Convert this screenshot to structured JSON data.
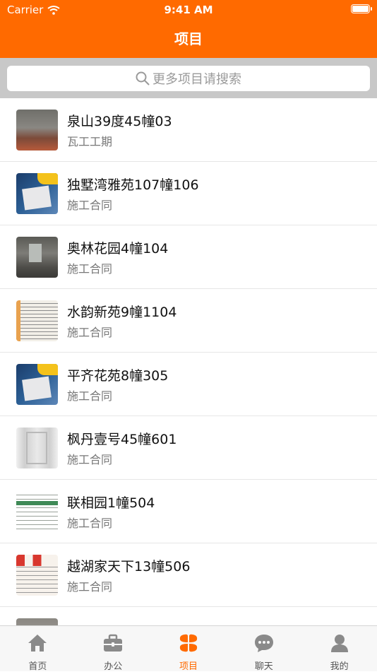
{
  "status_bar": {
    "carrier": "Carrier",
    "time": "9:41 AM"
  },
  "nav": {
    "title": "项目"
  },
  "search": {
    "placeholder": "更多项目请搜索"
  },
  "projects": [
    {
      "title": "泉山39度45幢03",
      "subtitle": "瓦工工期",
      "thumb": "concrete"
    },
    {
      "title": "独墅湾雅苑107幢106",
      "subtitle": "施工合同",
      "thumb": "bag"
    },
    {
      "title": "奥林花园4幢104",
      "subtitle": "施工合同",
      "thumb": "room"
    },
    {
      "title": "水韵新苑9幢1104",
      "subtitle": "施工合同",
      "thumb": "doc"
    },
    {
      "title": "平齐花苑8幢305",
      "subtitle": "施工合同",
      "thumb": "bag"
    },
    {
      "title": "枫丹壹号45幢601",
      "subtitle": "施工合同",
      "thumb": "plaster"
    },
    {
      "title": "联相园1幢504",
      "subtitle": "施工合同",
      "thumb": "form"
    },
    {
      "title": "越湖家天下13幢506",
      "subtitle": "施工合同",
      "thumb": "poster"
    }
  ],
  "tabs": [
    {
      "label": "首页",
      "icon": "home-icon",
      "active": false
    },
    {
      "label": "办公",
      "icon": "briefcase-icon",
      "active": false
    },
    {
      "label": "项目",
      "icon": "clover-icon",
      "active": true
    },
    {
      "label": "聊天",
      "icon": "chat-icon",
      "active": false
    },
    {
      "label": "我的",
      "icon": "person-icon",
      "active": false
    }
  ],
  "colors": {
    "accent": "#ff6a00",
    "tab_inactive": "#8a8a8a"
  }
}
